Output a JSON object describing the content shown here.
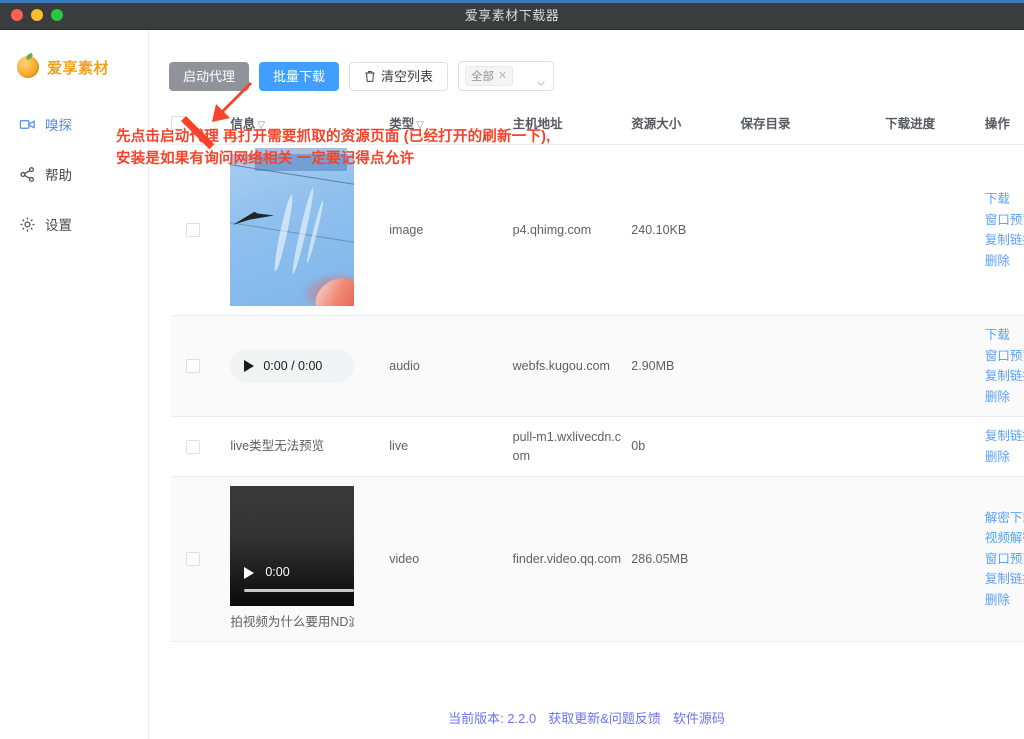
{
  "window": {
    "title": "爱享素材下载器",
    "traffic": [
      "close",
      "minimize",
      "zoom"
    ]
  },
  "sidebar": {
    "brand": "爱享素材",
    "items": [
      {
        "label": "嗅探",
        "icon": "video-camera-icon",
        "active": true
      },
      {
        "label": "帮助",
        "icon": "share-icon",
        "active": false
      },
      {
        "label": "设置",
        "icon": "gear-icon",
        "active": false
      }
    ]
  },
  "toolbar": {
    "proxy_label": "启动代理",
    "batch_label": "批量下载",
    "clear_label": "清空列表",
    "clear_icon": "trash-icon",
    "filter": {
      "tag": "全部",
      "remove_icon": "close-icon",
      "chevron": "chevron-down-icon"
    }
  },
  "annotation": {
    "line1": "先点击启动代理 再打开需要抓取的资源页面 (已经打开的刷新一下),",
    "line2": "安装是如果有询问网络相关 一定要记得点允许",
    "color": "#f8422a",
    "arrow_icon": "arrow-up-right-icon"
  },
  "table": {
    "headers": [
      {
        "label": "",
        "sort": ""
      },
      {
        "label": "信息",
        "sort": "▽"
      },
      {
        "label": "类型",
        "sort": "▽"
      },
      {
        "label": "主机地址",
        "sort": ""
      },
      {
        "label": "资源大小",
        "sort": ""
      },
      {
        "label": "保存目录",
        "sort": ""
      },
      {
        "label": "下载进度",
        "sort": ""
      },
      {
        "label": "操作",
        "sort": ""
      }
    ],
    "rows": [
      {
        "preview_kind": "image",
        "caption": "",
        "time": "",
        "type": "image",
        "host": "p4.qhimg.com",
        "size": "240.10KB",
        "dir": "",
        "progress": "",
        "ops": [
          "下载",
          "窗口预览",
          "复制链接",
          "删除"
        ]
      },
      {
        "preview_kind": "audio",
        "caption": "",
        "time": "0:00 / 0:00",
        "type": "audio",
        "host": "webfs.kugou.com",
        "size": "2.90MB",
        "dir": "",
        "progress": "",
        "ops": [
          "下载",
          "窗口预览",
          "复制链接",
          "删除"
        ]
      },
      {
        "preview_kind": "text",
        "caption": "live类型无法预览",
        "time": "",
        "type": "live",
        "host": "pull-m1.wxlivecdn.com",
        "size": "0b",
        "dir": "",
        "progress": "",
        "ops": [
          "复制链接",
          "删除"
        ]
      },
      {
        "preview_kind": "video",
        "caption": "拍视频为什么要用ND滤",
        "time": "0:00",
        "type": "video",
        "host": "finder.video.qq.com",
        "size": "286.05MB",
        "dir": "",
        "progress": "",
        "ops": [
          "解密下载(视频号)",
          "视频解密(视频号)",
          "窗口预览",
          "复制链接",
          "删除"
        ]
      }
    ]
  },
  "footer": {
    "version": "当前版本: 2.2.0",
    "update": "获取更新&问题反馈",
    "source": "软件源码",
    "color": "#6c72f0"
  }
}
